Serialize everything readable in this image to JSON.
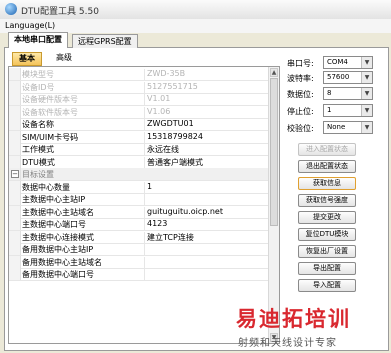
{
  "window": {
    "title": "DTU配置工具 5.50"
  },
  "menu": {
    "language": "Language(L)"
  },
  "outer_tabs": [
    "本地串口配置",
    "远程GPRS配置"
  ],
  "inner_tabs": [
    "基本",
    "高级"
  ],
  "grid_rows": [
    {
      "key": "模块型号",
      "value": "ZWD-35B",
      "dim": true
    },
    {
      "key": "设备ID号",
      "value": "5127551715",
      "dim": true
    },
    {
      "key": "设备硬件版本号",
      "value": "V1.01",
      "dim": true
    },
    {
      "key": "设备软件版本号",
      "value": "V1.06",
      "dim": true
    },
    {
      "key": "设备名称",
      "value": "ZWGDTU01"
    },
    {
      "key": "SIM/UIM卡号码",
      "value": "15318799824"
    },
    {
      "key": "工作模式",
      "value": "永远在线"
    },
    {
      "key": "DTU模式",
      "value": "普通客户端模式"
    },
    {
      "key": "目标设置",
      "value": "",
      "category": true
    },
    {
      "key": "数据中心数量",
      "value": "1"
    },
    {
      "key": "主数据中心主站IP",
      "value": ""
    },
    {
      "key": "主数据中心主站域名",
      "value": "guituguitu.oicp.net"
    },
    {
      "key": "主数据中心端口号",
      "value": "4123"
    },
    {
      "key": "主数据中心连接模式",
      "value": "建立TCP连接"
    },
    {
      "key": "备用数据中心主站IP",
      "value": ""
    },
    {
      "key": "备用数据中心主站域名",
      "value": ""
    },
    {
      "key": "备用数据中心端口号",
      "value": ""
    }
  ],
  "serial": {
    "port_label": "串口号:",
    "port_value": "COM4",
    "baud_label": "波特率:",
    "baud_value": "57600",
    "databits_label": "数据位:",
    "databits_value": "8",
    "stopbits_label": "停止位:",
    "stopbits_value": "1",
    "parity_label": "校验位:",
    "parity_value": "None"
  },
  "buttons": {
    "enter_config": "进入配置状态",
    "exit_config": "退出配置状态",
    "get_info": "获取信息",
    "read_signal": "获取信号强度",
    "submit": "提交更改",
    "reset_dtu": "复位DTU模块",
    "restore_factory": "恢复出厂设置",
    "export_config": "导出配置",
    "import_config": "导入配置"
  },
  "watermark": {
    "brand": "易迪拓培训",
    "slogan": "射频和天线设计专家"
  }
}
